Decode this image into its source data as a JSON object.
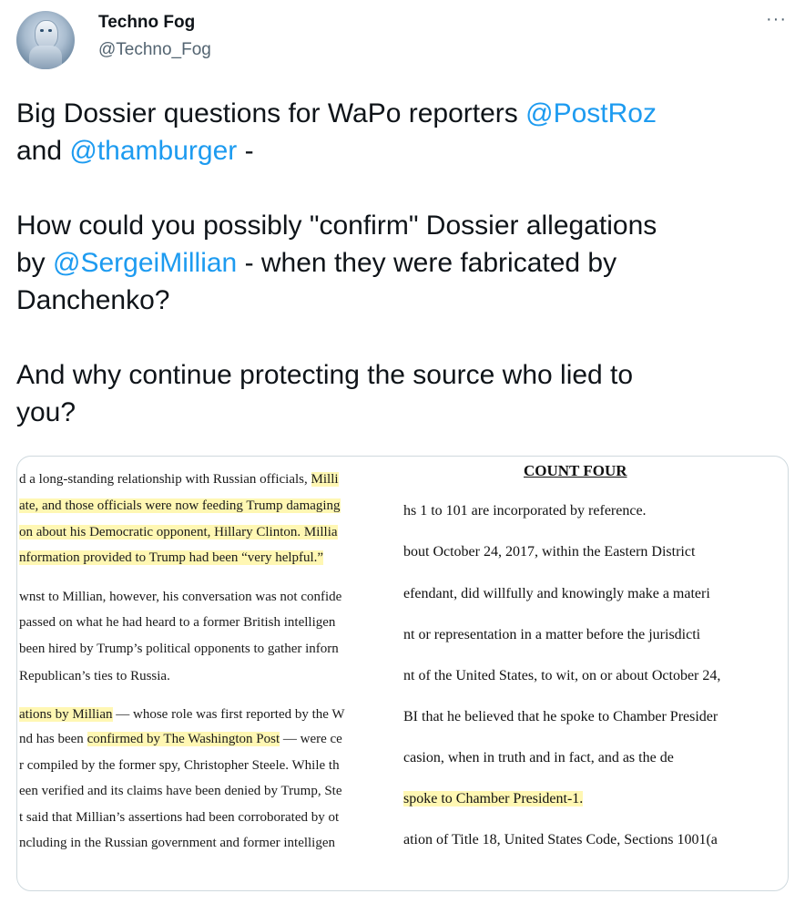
{
  "author": {
    "name": "Techno Fog",
    "handle": "@Techno_Fog"
  },
  "menu": {
    "more_label": "···"
  },
  "tweet": {
    "p1_a": "Big Dossier questions for WaPo reporters ",
    "mention1": "@PostRoz",
    "p1_b": "and ",
    "mention2": "@thamburger",
    "p1_c": " -",
    "p2_a": "How could you possibly \"confirm\" Dossier allegations",
    "p2_b": "by ",
    "mention3": "@SergeiMillian",
    "p2_c": " - when they were fabricated by",
    "p2_d": "Danchenko?",
    "p3_a": "And why continue protecting the source who lied to",
    "p3_b": "you?"
  },
  "doc_left": {
    "l1a": "d a long-standing relationship with Russian officials, ",
    "l1b": "Milli",
    "l2": "ate, and those officials were now feeding Trump damaging",
    "l3": "on about his Democratic opponent, Hillary Clinton. Millia",
    "l4": "nformation provided to Trump had been “very helpful.”",
    "l5": "wnst to Millian, however, his conversation was not confide",
    "l6": "passed on what he had heard to a former British intelligen",
    "l7": "been hired by Trump’s political opponents to gather inforn",
    "l8": "Republican’s ties to Russia.",
    "l9a": "ations by Millian",
    "l9b": " — whose role was first reported by the W",
    "l10a": "nd has been ",
    "l10b": "confirmed by The Washington Post",
    "l10c": " — were ce",
    "l11": "r compiled by the former spy, Christopher Steele. While th",
    "l12": "een verified and its claims have been denied by Trump, Ste",
    "l13": "t said that Millian’s assertions had been corroborated by ot",
    "l14": "ncluding in the Russian government and former intelligen"
  },
  "doc_right": {
    "title": "COUNT FOUR",
    "r1": "hs 1 to 101 are incorporated by reference.",
    "r2": "bout October 24, 2017, within the Eastern District",
    "r3": "efendant, did willfully and knowingly make a materi",
    "r4": "nt or representation in a matter before the jurisdicti",
    "r5": "nt of the United States, to wit, on or about October 24,",
    "r6": "BI that he believed that he spoke to Chamber Presider",
    "r7": "casion, when in truth and in fact, and as the de",
    "r8": "spoke to Chamber President-1.",
    "r9": "ation of Title 18, United States Code, Sections 1001(a"
  }
}
